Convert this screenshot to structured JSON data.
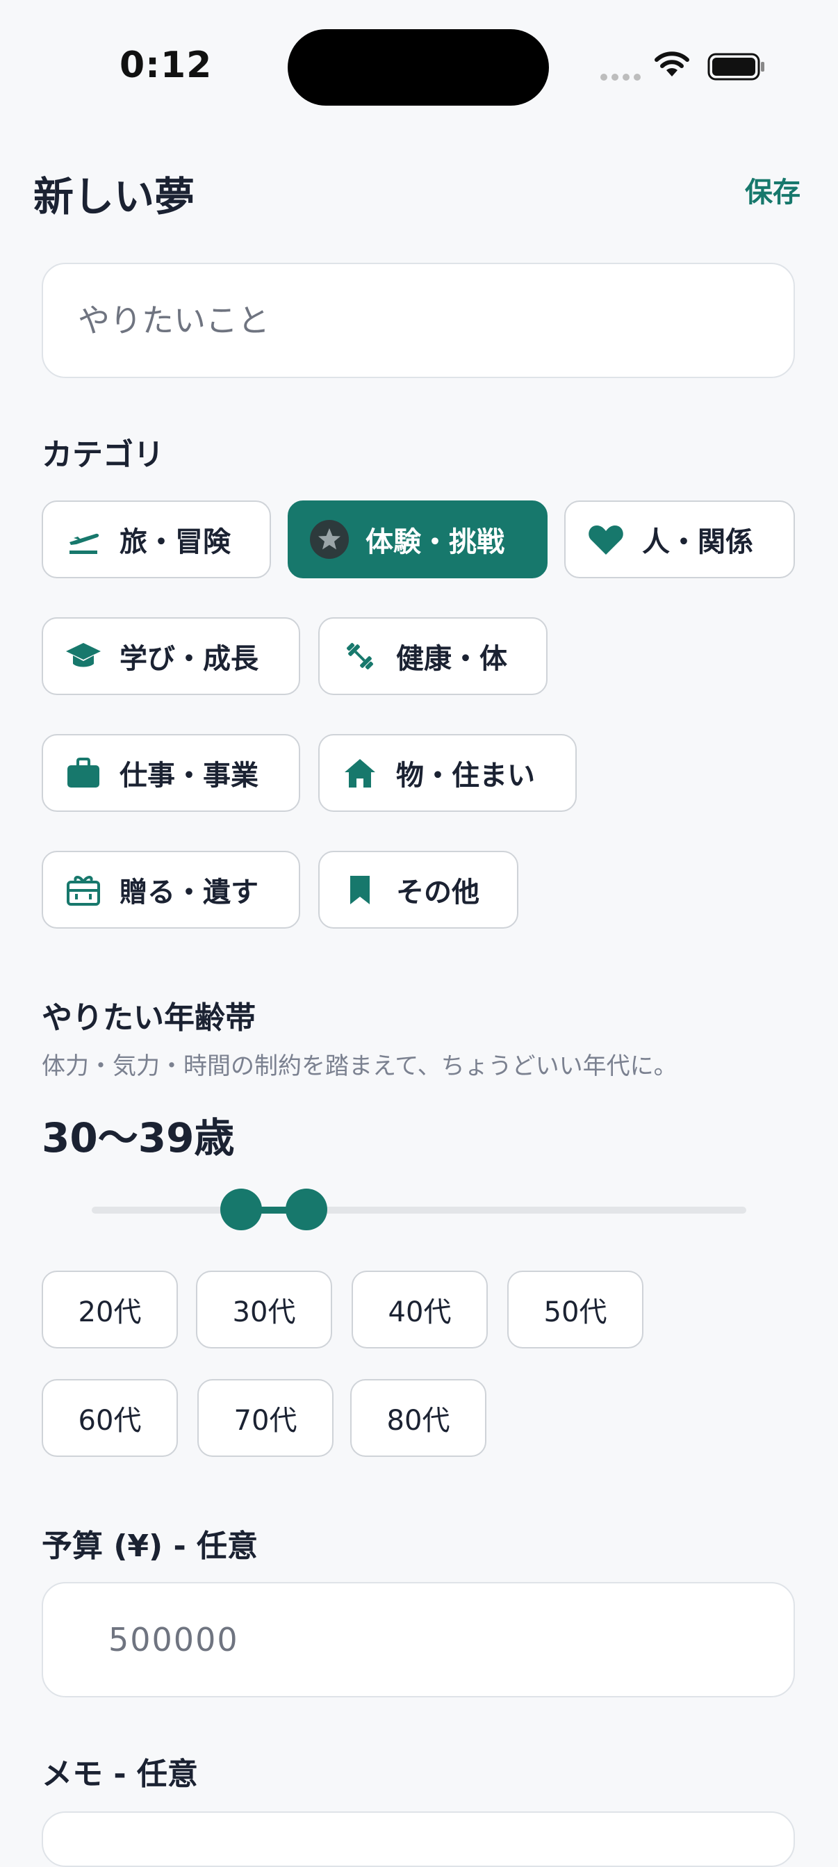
{
  "status": {
    "time": "0:12"
  },
  "header": {
    "title": "新しい夢",
    "save_label": "保存"
  },
  "title_input": {
    "placeholder": "やりたいこと",
    "value": ""
  },
  "category": {
    "label": "カテゴリ",
    "items": [
      {
        "label": "旅・冒険",
        "icon": "airplane-icon",
        "selected": false
      },
      {
        "label": "体験・挑戦",
        "icon": "star-icon",
        "selected": true
      },
      {
        "label": "人・関係",
        "icon": "heart-icon",
        "selected": false
      },
      {
        "label": "学び・成長",
        "icon": "graduation-cap-icon",
        "selected": false
      },
      {
        "label": "健康・体",
        "icon": "dumbbell-icon",
        "selected": false
      },
      {
        "label": "仕事・事業",
        "icon": "briefcase-icon",
        "selected": false
      },
      {
        "label": "物・住まい",
        "icon": "home-icon",
        "selected": false
      },
      {
        "label": "贈る・遺す",
        "icon": "gift-icon",
        "selected": false
      },
      {
        "label": "その他",
        "icon": "bookmark-icon",
        "selected": false
      }
    ]
  },
  "age": {
    "label": "やりたい年齢帯",
    "hint": "体力・気力・時間の制約を踏まえて、ちょうどいい年代に。",
    "range_text": "30〜39歳",
    "slider_min_fraction": 0.228,
    "slider_max_fraction": 0.328,
    "decades": [
      "20代",
      "30代",
      "40代",
      "50代",
      "60代",
      "70代",
      "80代"
    ]
  },
  "budget": {
    "label": "予算 (¥) - 任意",
    "placeholder": "500000",
    "value": ""
  },
  "memo": {
    "label": "メモ - 任意"
  },
  "colors": {
    "accent": "#17786c",
    "text": "#1b2232",
    "background": "#f7f8fa",
    "border": "#cfd3d8"
  }
}
